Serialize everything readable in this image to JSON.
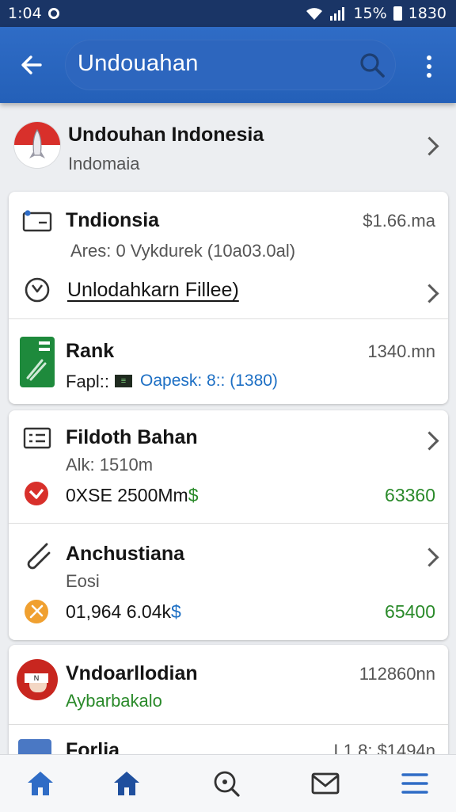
{
  "status": {
    "time": "1:04",
    "battery": "15%",
    "clock": "1830"
  },
  "appbar": {
    "search_text": "Undouahan"
  },
  "header_item": {
    "title": "Undouhan Indonesia",
    "subtitle": "Indomaia"
  },
  "card1": {
    "title": "Tndionsia",
    "amount": "$1.66.ma",
    "detail": "Ares:  0 Vykdurek (10a03.0al)",
    "action": "Unlodahkarn Fillee)"
  },
  "card2": {
    "title": "Rank",
    "amount": "1340.mn",
    "detail_label": "Fapl::",
    "detail_value": "Oapesk: 8:: (1380)"
  },
  "card3a": {
    "title": "Fildoth Bahan",
    "subtitle": "Alk: 1510m",
    "value": "0XSE 2500Mm",
    "value_suffix": "$",
    "amount": "63360"
  },
  "card3b": {
    "title": "Anchustiana",
    "subtitle": "Eosi",
    "value": "01,964 6.04k",
    "value_suffix": "$",
    "amount": "65400"
  },
  "card4": {
    "title": "Vndoarllodian",
    "subtitle": "Aybarbakalo",
    "amount": "112860nn",
    "badge": "N"
  },
  "card5": {
    "title": "Forlia",
    "amount": "L1.8: $1494n"
  },
  "colors": {
    "primary": "#2f6cc6",
    "status_bar": "#1a3566",
    "positive": "#2a8a2a",
    "link": "#1d6fc4",
    "danger": "#d8302b"
  },
  "icons": {
    "back": "arrow-left-icon",
    "search": "search-icon",
    "more": "more-vert-icon",
    "nav": [
      "home-icon",
      "home-filled-icon",
      "search-zoom-icon",
      "mail-icon",
      "menu-icon"
    ]
  }
}
